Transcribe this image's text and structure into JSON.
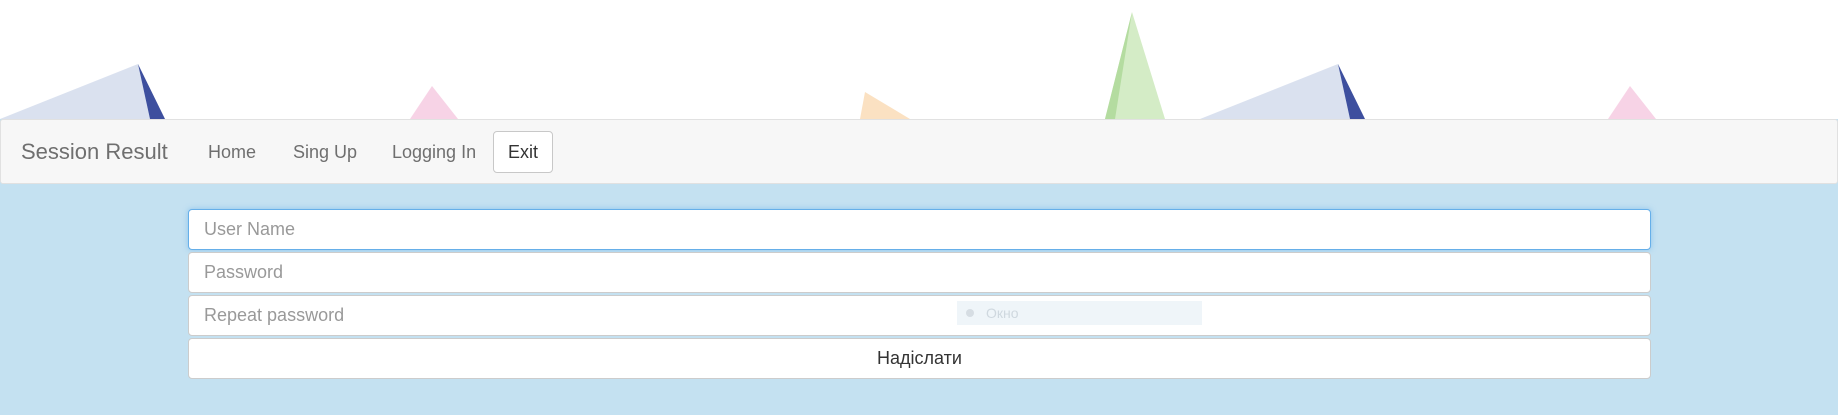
{
  "navbar": {
    "brand": "Session Result",
    "items": [
      {
        "label": "Home"
      },
      {
        "label": "Sing Up"
      },
      {
        "label": "Logging In"
      }
    ],
    "exit_label": "Exit"
  },
  "form": {
    "username": {
      "placeholder": "User Name",
      "value": ""
    },
    "password": {
      "placeholder": "Password",
      "value": ""
    },
    "repeat_password": {
      "placeholder": "Repeat password",
      "value": ""
    },
    "submit_label": "Надіслати"
  },
  "overlay": {
    "label": "Окно"
  },
  "colors": {
    "page_background": "#c4e1f1",
    "navbar_background": "#f7f7f7",
    "focus_border": "#66afe9"
  }
}
